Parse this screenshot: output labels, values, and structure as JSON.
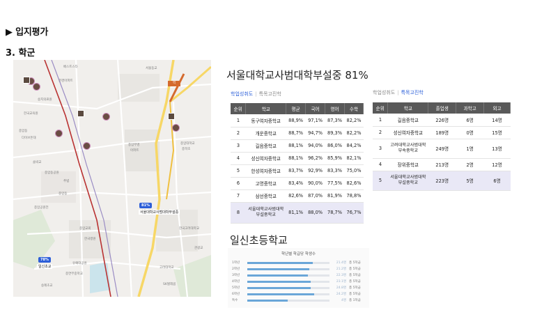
{
  "heading": {
    "section": "▶ 입지평가",
    "sub": "3. 학군"
  },
  "map": {
    "badges": [
      "81%",
      "78%"
    ],
    "school_name": "서울대학교사범대학부설중",
    "labels": [
      "서울대학교사범대학부설",
      "종암동",
      "일신초등학교",
      "숭례초교",
      "고려대"
    ]
  },
  "middle_school": {
    "title": "서울대학교사범대학부설중 81%",
    "tab_a": "학업성취도",
    "tab_b": "특목고진학",
    "achievement": {
      "columns": [
        "순위",
        "학교",
        "평균",
        "국어",
        "영어",
        "수학"
      ],
      "rows": [
        [
          "1",
          "동구여자중학교",
          "88,9%",
          "97,1%",
          "87,3%",
          "82,2%"
        ],
        [
          "2",
          "개운중학교",
          "88,7%",
          "94,7%",
          "89,3%",
          "82,2%"
        ],
        [
          "3",
          "길음중학교",
          "88,1%",
          "94,0%",
          "86,0%",
          "84,2%"
        ],
        [
          "4",
          "성신여자중학교",
          "88,1%",
          "96,2%",
          "85,9%",
          "82,1%"
        ],
        [
          "5",
          "한성여자중학교",
          "83,7%",
          "92,9%",
          "83,3%",
          "75,0%"
        ],
        [
          "6",
          "고명중학교",
          "83,4%",
          "90,0%",
          "77,5%",
          "82,6%"
        ],
        [
          "7",
          "삼선중학교",
          "82,6%",
          "87,0%",
          "81,9%",
          "78,8%"
        ],
        [
          "8",
          "서울대학교사범대학부설중학교",
          "81,1%",
          "88,0%",
          "78,7%",
          "76,7%"
        ]
      ]
    },
    "special": {
      "columns": [
        "순위",
        "학교",
        "졸업생",
        "과학고",
        "외고"
      ],
      "rows": [
        [
          "1",
          "길음중학교",
          "226명",
          "6명",
          "14명"
        ],
        [
          "2",
          "성신여자중학교",
          "189명",
          "0명",
          "15명"
        ],
        [
          "3",
          "고려대학교사범대학부속중학교",
          "249명",
          "1명",
          "13명"
        ],
        [
          "4",
          "장위중학교",
          "213명",
          "2명",
          "12명"
        ],
        [
          "5",
          "서울대학교사범대학부설중학교",
          "223명",
          "5명",
          "6명"
        ]
      ]
    }
  },
  "elementary": {
    "title": "일신초등학교",
    "chart_title": "학년별 학급당 학생수",
    "chart_data": {
      "type": "bar",
      "categories": [
        "1학년",
        "2학년",
        "3학년",
        "4학년",
        "5학년",
        "6학년",
        "특수"
      ],
      "values": [
        0.8,
        0.75,
        0.74,
        0.77,
        0.77,
        0.81,
        0.49
      ],
      "value_labels": [
        "21.4명",
        "21.2명",
        "22.3명",
        "23.1명",
        "24.8명",
        "24.2명",
        "4명"
      ],
      "class_labels": [
        "총 5학급",
        "총 5학급",
        "총 5학급",
        "총 5학급",
        "총 5학급",
        "총 5학급",
        "총 1학급"
      ]
    }
  },
  "colors": {
    "accent": "#2b5fd9",
    "header": "#595959",
    "highlight": "#e9e8f6",
    "bar": "#6aa6d8"
  }
}
